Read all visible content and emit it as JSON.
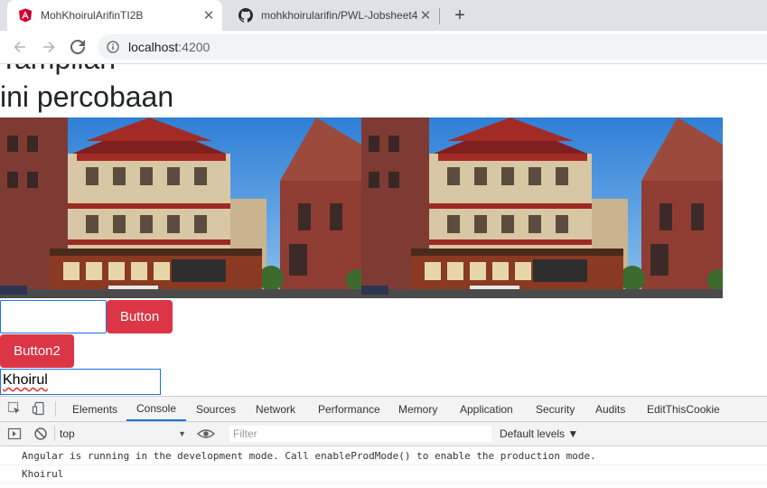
{
  "browser": {
    "tabs": [
      {
        "title": "MohKhoirulArifinTI2B",
        "favicon": "angular-icon",
        "active": true
      },
      {
        "title": "mohkhoirularifin/PWL-Jobsheet4",
        "favicon": "github-icon",
        "active": false
      }
    ],
    "close_glyph": "✕",
    "new_tab_glyph": "+",
    "url_host": "localhost",
    "url_port": ":4200"
  },
  "page": {
    "heading_cut": "Tampilan",
    "heading": "ini percobaan",
    "text_input_value": "",
    "button1_label": "Button",
    "button2_label": "Button2",
    "name_input_value": "Khoirul",
    "button_color": "#dc3545"
  },
  "devtools": {
    "tabs": [
      "Elements",
      "Console",
      "Sources",
      "Network",
      "Performance",
      "Memory",
      "Application",
      "Security",
      "Audits",
      "EditThisCookie"
    ],
    "active_tab": "Console",
    "context": "top",
    "context_arrow": "▼",
    "filter_placeholder": "Filter",
    "levels": "Default levels ▼",
    "logs": [
      "Angular is running in the development mode. Call enableProdMode() to enable the production mode.",
      "Khoirul"
    ]
  }
}
